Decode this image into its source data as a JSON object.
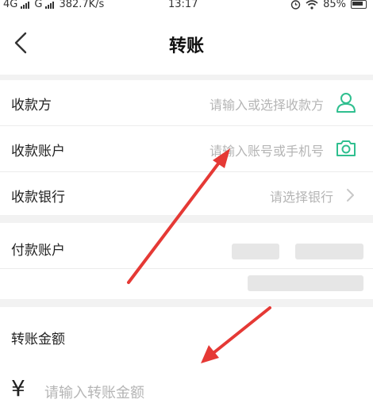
{
  "status_bar": {
    "network1": "4G",
    "network2": "G",
    "speed": "382.7K/s",
    "time": "13:17",
    "battery": "85%"
  },
  "nav": {
    "title": "转账"
  },
  "payee": {
    "name_label": "收款方",
    "name_placeholder": "请输入或选择收款方",
    "account_label": "收款账户",
    "account_placeholder": "请输入账号或手机号",
    "bank_label": "收款银行",
    "bank_placeholder": "请选择银行"
  },
  "payer": {
    "account_label": "付款账户"
  },
  "amount": {
    "label": "转账金额",
    "currency_symbol": "¥",
    "placeholder": "请输入转账金额"
  },
  "colors": {
    "accent": "#2fbf8f",
    "arrow": "#e53935"
  },
  "icons": [
    "back-arrow-icon",
    "contact-person-icon",
    "camera-icon",
    "chevron-right-icon",
    "signal-icon",
    "wifi-icon",
    "alarm-icon",
    "battery-icon"
  ]
}
